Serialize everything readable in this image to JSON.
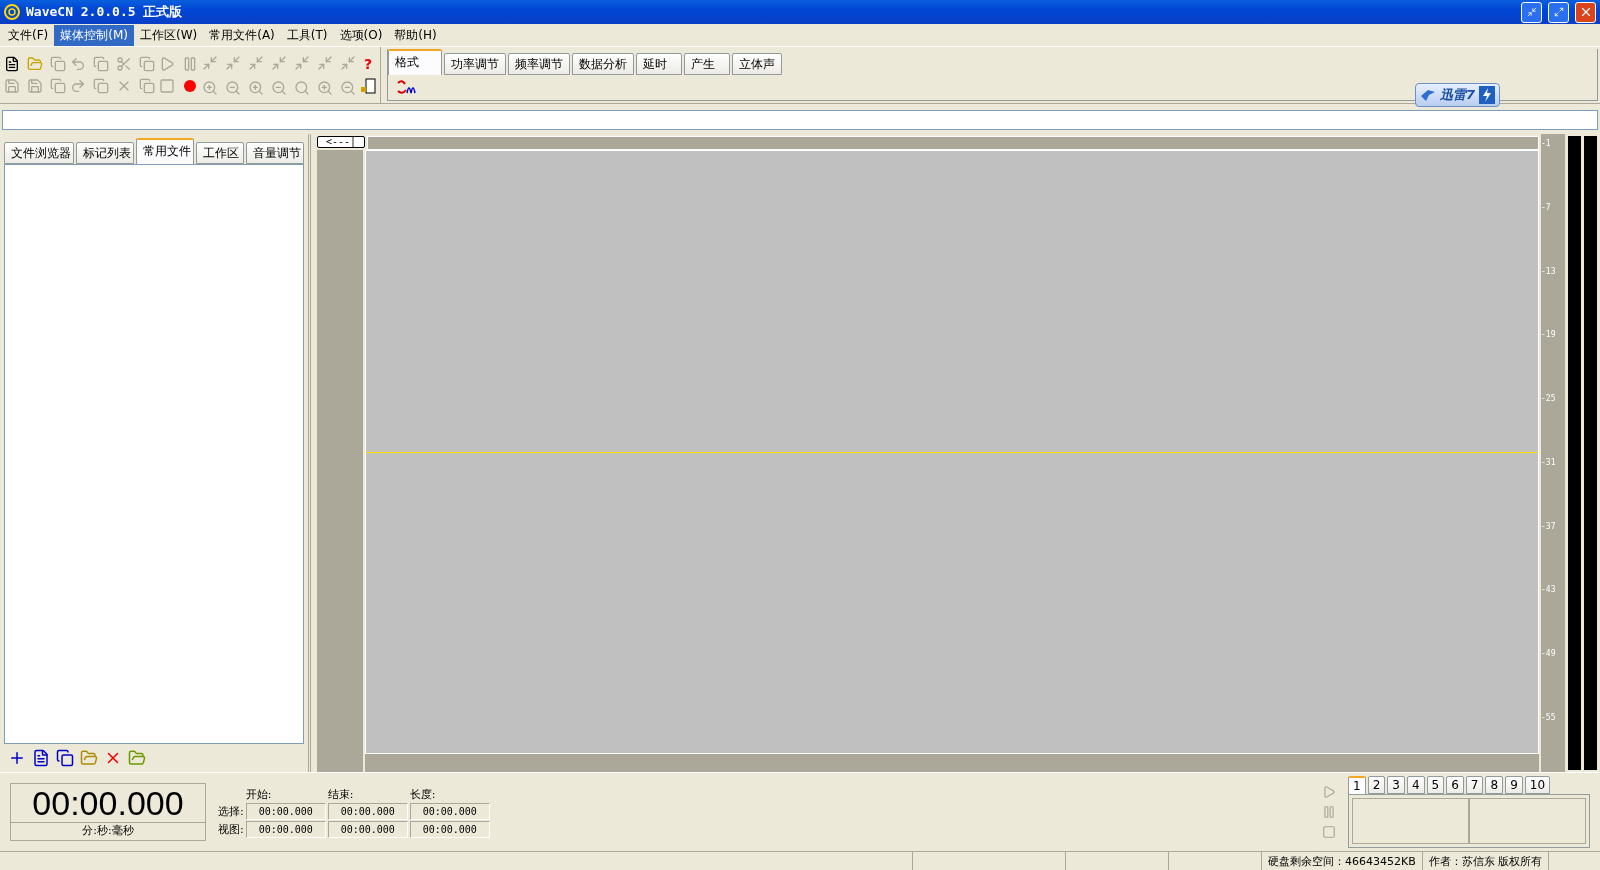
{
  "window": {
    "title": "WaveCN 2.0.0.5 正式版"
  },
  "menu": [
    {
      "label": "文件(F)",
      "selected": false
    },
    {
      "label": "媒体控制(M)",
      "selected": true
    },
    {
      "label": "工作区(W)",
      "selected": false
    },
    {
      "label": "常用文件(A)",
      "selected": false
    },
    {
      "label": "工具(T)",
      "selected": false
    },
    {
      "label": "选项(O)",
      "selected": false
    },
    {
      "label": "帮助(H)",
      "selected": false
    }
  ],
  "effect_tabs": [
    {
      "label": "格式",
      "selected": true
    },
    {
      "label": "功率调节",
      "selected": false
    },
    {
      "label": "频率调节",
      "selected": false
    },
    {
      "label": "数据分析",
      "selected": false
    },
    {
      "label": "延时",
      "selected": false
    },
    {
      "label": "产生",
      "selected": false
    },
    {
      "label": "立体声",
      "selected": false
    }
  ],
  "download_badge": {
    "label": "迅雷7"
  },
  "help_button": {
    "label": "?"
  },
  "side_tabs": [
    {
      "label": "文件浏览器",
      "selected": false
    },
    {
      "label": "标记列表",
      "selected": false
    },
    {
      "label": "常用文件",
      "selected": true
    },
    {
      "label": "工作区",
      "selected": false
    },
    {
      "label": "音量调节",
      "selected": false
    }
  ],
  "collapse_button": {
    "label": "<---|"
  },
  "meter_scale": [
    "-1",
    "-7",
    "-13",
    "-19",
    "-25",
    "-31",
    "-37",
    "-43",
    "-49",
    "-55"
  ],
  "time_display": {
    "value": "00:00.000",
    "unit": "分:秒:毫秒"
  },
  "range": {
    "columns": [
      "开始:",
      "结束:",
      "长度:"
    ],
    "rows": [
      {
        "label": "选择:",
        "values": [
          "00:00.000",
          "00:00.000",
          "00:00.000"
        ]
      },
      {
        "label": "视图:",
        "values": [
          "00:00.000",
          "00:00.000",
          "00:00.000"
        ]
      }
    ]
  },
  "slot_tabs": [
    {
      "label": "1",
      "selected": true
    },
    {
      "label": "2",
      "selected": false
    },
    {
      "label": "3",
      "selected": false
    },
    {
      "label": "4",
      "selected": false
    },
    {
      "label": "5",
      "selected": false
    },
    {
      "label": "6",
      "selected": false
    },
    {
      "label": "7",
      "selected": false
    },
    {
      "label": "8",
      "selected": false
    },
    {
      "label": "9",
      "selected": false
    },
    {
      "label": "10",
      "selected": false
    }
  ],
  "status_bar": [
    "硬盘剩余空间：46643452KB",
    "作者：苏信东  版权所有"
  ]
}
